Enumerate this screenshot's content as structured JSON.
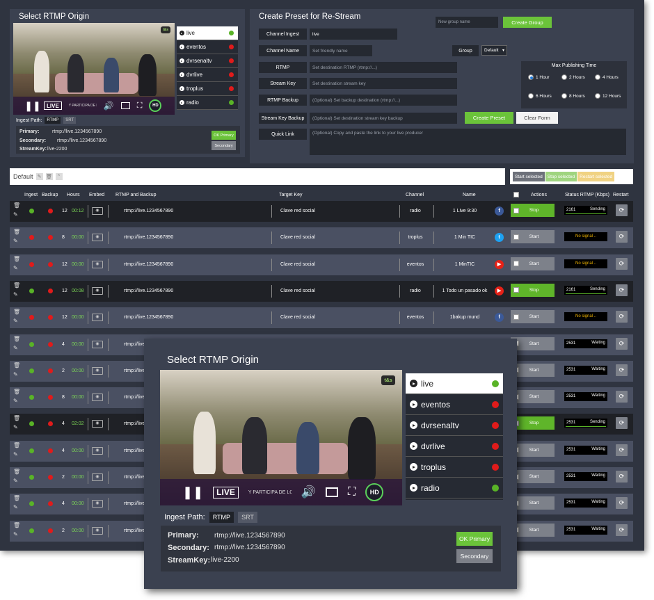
{
  "origin_panel": {
    "title": "Select RTMP Origin",
    "live_label": "LIVE",
    "hd_label": "HD",
    "ticker": "Y PARTICIPA DE LO",
    "logo": "t&s",
    "origins": [
      {
        "name": "live",
        "status": "green",
        "active": true
      },
      {
        "name": "eventos",
        "status": "red",
        "active": false
      },
      {
        "name": "dvrsenaltv",
        "status": "red",
        "active": false
      },
      {
        "name": "dvrlive",
        "status": "red",
        "active": false
      },
      {
        "name": "troplus",
        "status": "red",
        "active": false
      },
      {
        "name": "radio",
        "status": "green",
        "active": false
      }
    ],
    "ingest_label": "Ingest Path:",
    "ingest_options": [
      "RTMP",
      "SRT"
    ],
    "primary_label": "Primary:",
    "primary_value": "rtmp://live.1234567890",
    "secondary_label": "Secondary:",
    "secondary_value": "rtmp://live.1234567890",
    "streamkey_label": "StreamKey:",
    "streamkey_value": "live-2200",
    "ok_primary": "OK Primary",
    "secondary_btn": "Secondary"
  },
  "preset": {
    "title": "Create Preset for Re-Stream",
    "group_placeholder": "New group name",
    "create_group": "Create Group",
    "channel_ingest_label": "Channel Ingest",
    "channel_ingest_value": "live",
    "channel_name_label": "Channel Name",
    "channel_name_placeholder": "Set friendly name",
    "group_label": "Group",
    "group_value": "Default",
    "rtmp_label": "RTMP",
    "rtmp_placeholder": "Set destination RTMP (rtmp://...)",
    "stream_key_label": "Stream Key",
    "stream_key_placeholder": "Set destination stream key",
    "rtmp_backup_label": "RTMP Backup",
    "rtmp_backup_placeholder": "(Optional) Set backup destination (rtmp://...)",
    "stream_key_backup_label": "Stream Key Backup",
    "stream_key_backup_placeholder": "(Optional) Set destination stream key backup",
    "quick_link_label": "Quick Link",
    "quick_link_placeholder": "(Optional) Copy and paste the link to your live producer",
    "create_preset": "Create Preset",
    "clear_form": "Clear Form",
    "max_time_title": "Max Publishing Time",
    "max_time_options": [
      "1 Hour",
      "2 Hours",
      "4 Hours",
      "6 Hours",
      "8 Hours",
      "12 Hours"
    ],
    "max_time_selected": 0
  },
  "group_bar": {
    "name": "Default",
    "start_selected": "Start selected",
    "stop_selected": "Stop selected",
    "restart_selected": "Restart selected"
  },
  "table": {
    "headers": {
      "ingest": "Ingest",
      "backup": "Backup",
      "hours": "Hours",
      "embed": "Embed",
      "rtmp": "RTMP and Backup",
      "target": "Target Key",
      "channel": "Channel",
      "name": "Name",
      "actions": "Actions",
      "status": "Status RTMP (Kbps)",
      "restart": "Restart"
    },
    "rows": [
      {
        "ingest": "green",
        "backup": "red",
        "hours": "12",
        "time": "00:12",
        "rtmp": "rtmp://live.1234567890",
        "target": "Clave red social",
        "channel": "radio",
        "name": "1 Live 9:30",
        "social": "facebook",
        "action": "Stop",
        "status_value": "2161",
        "status_text": "Sending",
        "status_kind": "sending",
        "dark": true
      },
      {
        "ingest": "red",
        "backup": "red",
        "hours": "8",
        "time": "00:00",
        "rtmp": "rtmp://live.1234567890",
        "target": "Clave red social",
        "channel": "troplus",
        "name": "1 Min TIC",
        "social": "twitter",
        "action": "Start",
        "status_value": "",
        "status_text": "No signal ..",
        "status_kind": "nosignal",
        "dark": false
      },
      {
        "ingest": "red",
        "backup": "red",
        "hours": "12",
        "time": "00:00",
        "rtmp": "rtmp://live.1234567890",
        "target": "Clave red social",
        "channel": "eventos",
        "name": "1 MinTIC",
        "social": "youtube",
        "action": "Start",
        "status_value": "",
        "status_text": "No signal ..",
        "status_kind": "nosignal",
        "dark": false
      },
      {
        "ingest": "green",
        "backup": "red",
        "hours": "12",
        "time": "00:08",
        "rtmp": "rtmp://live.1234567890",
        "target": "Clave red social",
        "channel": "radio",
        "name": "1 Todo un pasado ok",
        "social": "youtube",
        "action": "Stop",
        "status_value": "2161",
        "status_text": "Sending",
        "status_kind": "sending",
        "dark": true
      },
      {
        "ingest": "red",
        "backup": "red",
        "hours": "12",
        "time": "00:00",
        "rtmp": "rtmp://live.1234567890",
        "target": "Clave red social",
        "channel": "eventos",
        "name": "1bakup mund",
        "social": "facebook",
        "action": "Start",
        "status_value": "",
        "status_text": "No signal ..",
        "status_kind": "nosignal",
        "dark": false
      },
      {
        "ingest": "green",
        "backup": "red",
        "hours": "4",
        "time": "00:00",
        "rtmp": "rtmp://live.1234567890",
        "target": "",
        "channel": "",
        "name": "",
        "social": "",
        "action": "Start",
        "status_value": "2531",
        "status_text": "Waiting",
        "status_kind": "waiting",
        "dark": false
      },
      {
        "ingest": "green",
        "backup": "red",
        "hours": "2",
        "time": "00:00",
        "rtmp": "rtmp://live.1234567890",
        "target": "",
        "channel": "",
        "name": "",
        "social": "",
        "action": "Start",
        "status_value": "2531",
        "status_text": "Waiting",
        "status_kind": "waiting",
        "dark": false
      },
      {
        "ingest": "green",
        "backup": "red",
        "hours": "8",
        "time": "00:00",
        "rtmp": "rtmp://live.1234567890",
        "target": "",
        "channel": "",
        "name": "",
        "social": "",
        "action": "Start",
        "status_value": "2531",
        "status_text": "Waiting",
        "status_kind": "waiting",
        "dark": false
      },
      {
        "ingest": "green",
        "backup": "red",
        "hours": "4",
        "time": "02:02",
        "rtmp": "rtmp://live.1234567890",
        "target": "",
        "channel": "",
        "name": "",
        "social": "",
        "action": "Stop",
        "status_value": "2531",
        "status_text": "Sending",
        "status_kind": "sending",
        "dark": true
      },
      {
        "ingest": "green",
        "backup": "red",
        "hours": "4",
        "time": "00:00",
        "rtmp": "rtmp://live.1234567890",
        "target": "",
        "channel": "",
        "name": "",
        "social": "",
        "action": "Start",
        "status_value": "2531",
        "status_text": "Waiting",
        "status_kind": "waiting",
        "dark": false
      },
      {
        "ingest": "green",
        "backup": "red",
        "hours": "2",
        "time": "00:00",
        "rtmp": "rtmp://live.1234567890",
        "target": "",
        "channel": "",
        "name": "",
        "social": "",
        "action": "Start",
        "status_value": "2531",
        "status_text": "Waiting",
        "status_kind": "waiting",
        "dark": false
      },
      {
        "ingest": "green",
        "backup": "red",
        "hours": "4",
        "time": "00:00",
        "rtmp": "rtmp://live.1234567890",
        "target": "",
        "channel": "",
        "name": "",
        "social": "",
        "action": "Start",
        "status_value": "2531",
        "status_text": "Waiting",
        "status_kind": "waiting",
        "dark": false
      },
      {
        "ingest": "green",
        "backup": "red",
        "hours": "2",
        "time": "00:00",
        "rtmp": "rtmp://live.1234567890",
        "target": "",
        "channel": "",
        "name": "",
        "social": "",
        "action": "Start",
        "status_value": "2531",
        "status_text": "Waiting",
        "status_kind": "waiting",
        "dark": false
      }
    ]
  },
  "colors": {
    "green": "#59b327",
    "red": "#e01b1b",
    "accent_green": "#6bc33a",
    "panel": "#3b4150",
    "bg": "#2f3440"
  }
}
